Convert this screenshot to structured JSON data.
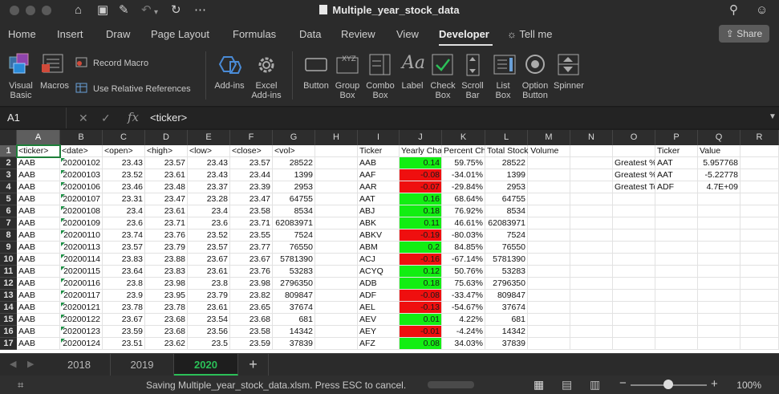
{
  "window": {
    "title": "Multiple_year_stock_data"
  },
  "tabs": [
    "Home",
    "Insert",
    "Draw",
    "Page Layout",
    "Formulas",
    "Data",
    "Review",
    "View",
    "Developer",
    "Tell me"
  ],
  "active_tab": "Developer",
  "share_label": "Share",
  "ribbon": {
    "visual_basic": "Visual Basic",
    "macros": "Macros",
    "record_macro": "Record Macro",
    "relative_refs": "Use Relative References",
    "addins": "Add-ins",
    "excel_addins": "Excel Add-ins",
    "controls": [
      "Button",
      "Group Box",
      "Combo Box",
      "Label",
      "Check Box",
      "Scroll Bar",
      "List Box",
      "Option Button",
      "Spinner"
    ]
  },
  "formula_bar": {
    "name_box": "A1",
    "formula": "<ticker>",
    "fx": "fx"
  },
  "columns": [
    "A",
    "B",
    "C",
    "D",
    "E",
    "F",
    "G",
    "H",
    "I",
    "J",
    "K",
    "L",
    "M",
    "N",
    "O",
    "P",
    "Q",
    "R"
  ],
  "rows": [
    "1",
    "2",
    "3",
    "4",
    "5",
    "6",
    "7",
    "8",
    "9",
    "10",
    "11",
    "12",
    "13",
    "14",
    "15",
    "16",
    "17"
  ],
  "sheet": {
    "raw_headers": [
      "<ticker>",
      "<date>",
      "<open>",
      "<high>",
      "<low>",
      "<close>",
      "<vol>"
    ],
    "raw_rows": [
      [
        "AAB",
        "20200102",
        "23.43",
        "23.57",
        "23.43",
        "23.57",
        "28522"
      ],
      [
        "AAB",
        "20200103",
        "23.52",
        "23.61",
        "23.43",
        "23.44",
        "1399"
      ],
      [
        "AAB",
        "20200106",
        "23.46",
        "23.48",
        "23.37",
        "23.39",
        "2953"
      ],
      [
        "AAB",
        "20200107",
        "23.31",
        "23.47",
        "23.28",
        "23.47",
        "64755"
      ],
      [
        "AAB",
        "20200108",
        "23.4",
        "23.61",
        "23.4",
        "23.58",
        "8534"
      ],
      [
        "AAB",
        "20200109",
        "23.6",
        "23.71",
        "23.6",
        "23.71",
        "62083971"
      ],
      [
        "AAB",
        "20200110",
        "23.74",
        "23.76",
        "23.52",
        "23.55",
        "7524"
      ],
      [
        "AAB",
        "20200113",
        "23.57",
        "23.79",
        "23.57",
        "23.77",
        "76550"
      ],
      [
        "AAB",
        "20200114",
        "23.83",
        "23.88",
        "23.67",
        "23.67",
        "5781390"
      ],
      [
        "AAB",
        "20200115",
        "23.64",
        "23.83",
        "23.61",
        "23.76",
        "53283"
      ],
      [
        "AAB",
        "20200116",
        "23.8",
        "23.98",
        "23.8",
        "23.98",
        "2796350"
      ],
      [
        "AAB",
        "20200117",
        "23.9",
        "23.95",
        "23.79",
        "23.82",
        "809847"
      ],
      [
        "AAB",
        "20200121",
        "23.78",
        "23.78",
        "23.61",
        "23.65",
        "37674"
      ],
      [
        "AAB",
        "20200122",
        "23.67",
        "23.68",
        "23.54",
        "23.68",
        "681"
      ],
      [
        "AAB",
        "20200123",
        "23.59",
        "23.68",
        "23.56",
        "23.58",
        "14342"
      ],
      [
        "AAB",
        "20200124",
        "23.51",
        "23.62",
        "23.5",
        "23.59",
        "37839"
      ]
    ],
    "summary_headers": [
      "Ticker",
      "Yearly Char",
      "Percent Ch",
      "Total Stock Volume"
    ],
    "summary_rows": [
      [
        "AAB",
        "0.14",
        "59.75%",
        "28522"
      ],
      [
        "AAF",
        "-0.08",
        "-34.01%",
        "1399"
      ],
      [
        "AAR",
        "-0.07",
        "-29.84%",
        "2953"
      ],
      [
        "AAT",
        "0.16",
        "68.64%",
        "64755"
      ],
      [
        "ABJ",
        "0.18",
        "76.92%",
        "8534"
      ],
      [
        "ABK",
        "0.11",
        "46.61%",
        "62083971"
      ],
      [
        "ABKV",
        "-0.19",
        "-80.03%",
        "7524"
      ],
      [
        "ABM",
        "0.2",
        "84.85%",
        "76550"
      ],
      [
        "ACJ",
        "-0.16",
        "-67.14%",
        "5781390"
      ],
      [
        "ACYQ",
        "0.12",
        "50.76%",
        "53283"
      ],
      [
        "ADB",
        "0.18",
        "75.63%",
        "2796350"
      ],
      [
        "ADF",
        "-0.08",
        "-33.47%",
        "809847"
      ],
      [
        "AEL",
        "-0.13",
        "-54.67%",
        "37674"
      ],
      [
        "AEV",
        "0.01",
        "4.22%",
        "681"
      ],
      [
        "AEY",
        "-0.01",
        "-4.24%",
        "14342"
      ],
      [
        "AFZ",
        "0.08",
        "34.03%",
        "37839"
      ]
    ],
    "greatest_headers": [
      "Ticker",
      "Value"
    ],
    "greatest_rows": [
      [
        "Greatest %",
        "AAT",
        "5.957768"
      ],
      [
        "Greatest %",
        "AAT",
        "-5.22778"
      ],
      [
        "Greatest To",
        "ADF",
        "4.7E+09"
      ]
    ],
    "colors": {
      "positive": "#12ee12",
      "negative": "#ef0f0f"
    }
  },
  "sheet_tabs": [
    "2018",
    "2019",
    "2020"
  ],
  "active_sheet": "2020",
  "add_sheet": "+",
  "status": {
    "message": "Saving Multiple_year_stock_data.xlsm. Press ESC to cancel.",
    "zoom": "100%"
  }
}
